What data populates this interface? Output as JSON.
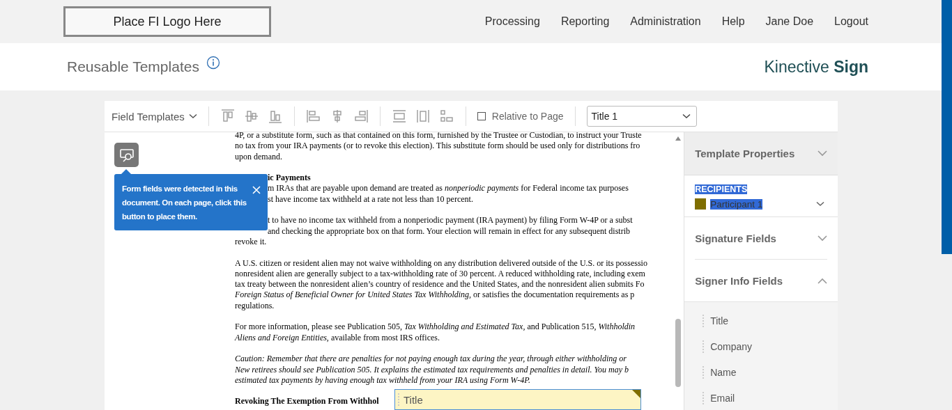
{
  "header": {
    "logo": "Place FI Logo Here",
    "nav": [
      "Processing",
      "Reporting",
      "Administration",
      "Help",
      "Jane Doe",
      "Logout"
    ]
  },
  "page": {
    "title": "Reusable Templates",
    "brand_light": "Kinective",
    "brand_bold": "Sign"
  },
  "toolbar": {
    "menu": "Field Templates",
    "relative": {
      "label": "Relative to Page",
      "checked": false
    },
    "select": {
      "value": "Title 1"
    }
  },
  "tooltip": {
    "text": "Form fields were detected in this document. On each page, click this button to place them."
  },
  "document": {
    "paragraphs": [
      {
        "kind": "body",
        "lines": [
          {
            "text": "4P, or a substitute form, such as that contained on this form, furnished by the Trustee or Custodian, to instruct your Truste",
            "kind": "full"
          },
          {
            "text": "no tax from your IRA payments (or to revoke this election). This substitute form should be used only for distributions fro",
            "kind": "full"
          },
          {
            "text": "upon demand.",
            "kind": "full"
          }
        ]
      },
      {
        "kind": "body",
        "lines": [
          {
            "text": "**ic Payments**",
            "kind": "fragment"
          },
          {
            "text": "m IRAs that are payable upon demand are treated as *nonperiodic payments* for Federal income tax purposes",
            "kind": "fragment"
          },
          {
            "text": "st have income tax withheld at a rate not less than 10 percent.",
            "kind": "fragment"
          }
        ]
      },
      {
        "kind": "body",
        "lines": [
          {
            "text": "t to have no income tax withheld from a nonperiodic payment (IRA payment) by filing Form W-4P or a subst",
            "kind": "fragment"
          },
          {
            "text": "and checking the appropriate box on that form. Your election will remain in effect for any subsequent distrib",
            "kind": "fragment"
          },
          {
            "text": "revoke it.",
            "kind": "full"
          }
        ]
      },
      {
        "kind": "body",
        "lines": [
          {
            "text": "A U.S. citizen or resident alien may not waive withholding on any distribution delivered outside of the U.S. or its possessio",
            "kind": "full"
          },
          {
            "text": "nonresident alien are generally subject to a tax-withholding rate of 30 percent. A reduced withholding rate, including exem",
            "kind": "full"
          },
          {
            "text": "tax treaty between the nonresident alien’s country of residence and the United States, and the nonresident alien submits Fo",
            "kind": "full"
          },
          {
            "text": "*Foreign Status of Beneficial Owner for United States Tax Withholding,* or satisfies the documentation requirements as p",
            "kind": "full"
          },
          {
            "text": "regulations.",
            "kind": "full"
          }
        ]
      },
      {
        "kind": "body",
        "lines": [
          {
            "text": "For more information, please see Publication 505, *Tax Withholding and Estimated Tax,* and Publication 515, *Withholdin*",
            "kind": "full"
          },
          {
            "text": "*Aliens and Foreign Entities,* available from most IRS offices.",
            "kind": "full"
          }
        ]
      },
      {
        "kind": "italic",
        "lines": [
          {
            "text": "Caution: Remember that there are penalties for not paying enough tax during the year, through either withholding or",
            "kind": "full"
          },
          {
            "text": "New retirees should see Publication 505. It explains the estimated tax requirements and penalties in detail. You may b",
            "kind": "full"
          },
          {
            "text": "estimated tax payments by having enough tax withheld from your IRA using Form W-4P.",
            "kind": "full"
          }
        ]
      },
      {
        "kind": "heading",
        "lines": [
          {
            "text": "Revoking The Exemption From Withhol",
            "kind": "full"
          }
        ]
      }
    ]
  },
  "placed_field": {
    "label": "Title"
  },
  "panel": {
    "template_properties": {
      "title": "Template Properties",
      "expanded": false
    },
    "recipients": {
      "label": "RECIPIENTS",
      "text_selected": true,
      "participants": [
        {
          "name": "Participant 1",
          "color": "#7f6e00",
          "text_selected": true
        }
      ]
    },
    "sections": [
      {
        "title": "Signature Fields",
        "expanded": false
      },
      {
        "title": "Signer Info Fields",
        "expanded": true,
        "fields": [
          "Title",
          "Company",
          "Name",
          "Email"
        ]
      }
    ]
  }
}
